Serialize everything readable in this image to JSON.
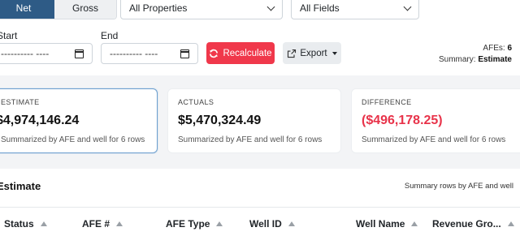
{
  "toggle": {
    "net_label": "Net",
    "gross_label": "Gross",
    "active": "Net"
  },
  "filters": {
    "properties": {
      "value": "All Properties",
      "icon": "chevron-down-icon"
    },
    "fields": {
      "value": "All Fields",
      "icon": "chevron-down-icon"
    }
  },
  "date_range": {
    "start_label": "Start",
    "start_value": "---------- ----",
    "end_label": "End",
    "end_value": "---------- ----",
    "icon": "calendar-icon"
  },
  "actions": {
    "recalculate_label": "Recalculate",
    "recalculate_icon": "refresh-icon",
    "recalculate_color": "#f0384b",
    "export_label": "Export",
    "export_icon": "export-icon"
  },
  "meta": {
    "afes_label": "AFEs:",
    "afes_value": "6",
    "summary_label": "Summary:",
    "summary_value": "Estimate"
  },
  "cards": [
    {
      "title": "Estimate",
      "value": "$4,974,146.24",
      "subtitle": "Summarized by AFE and well for 6 rows",
      "selected": true
    },
    {
      "title": "Actuals",
      "value": "$5,470,324.49",
      "subtitle": "Summarized by AFE and well for 6 rows",
      "selected": false
    },
    {
      "title": "Difference",
      "value": "($496,178.25)",
      "subtitle": "Summarized by AFE and well for 6 rows",
      "negative_color": "#e8334a"
    }
  ],
  "table": {
    "title": "Estimate",
    "note": "Summary rows by AFE and well",
    "columns": [
      "Status",
      "AFE #",
      "AFE Type",
      "Well ID",
      "Well Name",
      "Revenue Gro..."
    ],
    "sort_icon": "sort-up-icon"
  },
  "colors": {
    "accent": "#2e5b86",
    "danger": "#f0384b",
    "negative": "#e8334a"
  }
}
